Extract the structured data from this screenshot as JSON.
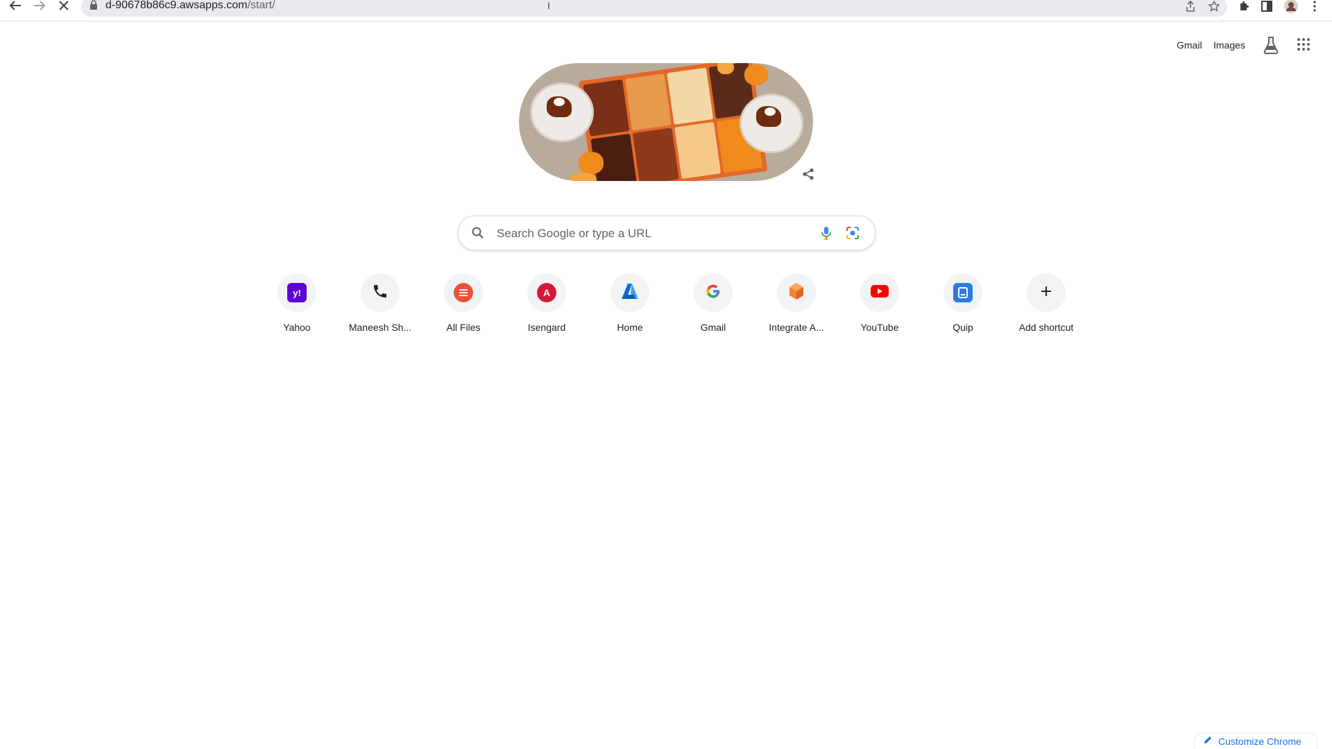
{
  "browser": {
    "url_host": "d-90678b86c9.awsapps.com",
    "url_path": "/start/",
    "icons": [
      "back-arrow-icon",
      "forward-arrow-icon",
      "stop-loading-icon",
      "lock-icon",
      "share-icon",
      "bookmark-star-icon",
      "extensions-puzzle-icon",
      "side-panel-icon",
      "profile-avatar-icon",
      "more-menu-icon"
    ]
  },
  "header": {
    "gmail": "Gmail",
    "images": "Images",
    "icons": [
      "labs-flask-icon",
      "google-apps-grid-icon"
    ]
  },
  "search": {
    "placeholder": "Search Google or type a URL",
    "icons": [
      "search-icon",
      "microphone-icon",
      "google-lens-icon"
    ]
  },
  "shortcuts": [
    {
      "label": "Yahoo",
      "icon": "yahoo-icon",
      "color": "#5f01d1"
    },
    {
      "label": "Maneesh Sh...",
      "icon": "phone-icon",
      "color": "#202124"
    },
    {
      "label": "All Files",
      "icon": "all-files-icon",
      "color": "#e8533a"
    },
    {
      "label": "Isengard",
      "icon": "isengard-icon",
      "color": "#d4183b"
    },
    {
      "label": "Home",
      "icon": "azure-icon",
      "color": "#0a6ed1"
    },
    {
      "label": "Gmail",
      "icon": "google-g-icon",
      "color": "#4285f4"
    },
    {
      "label": "Integrate A...",
      "icon": "integrate-cube-icon",
      "color": "#f58536"
    },
    {
      "label": "YouTube",
      "icon": "youtube-icon",
      "color": "#ff0000"
    },
    {
      "label": "Quip",
      "icon": "quip-icon",
      "color": "#2c7be5"
    },
    {
      "label": "Add shortcut",
      "icon": "plus-icon",
      "color": "#202124"
    }
  ],
  "footer": {
    "customize_label": "Customize Chrome",
    "icon": "pencil-icon"
  }
}
